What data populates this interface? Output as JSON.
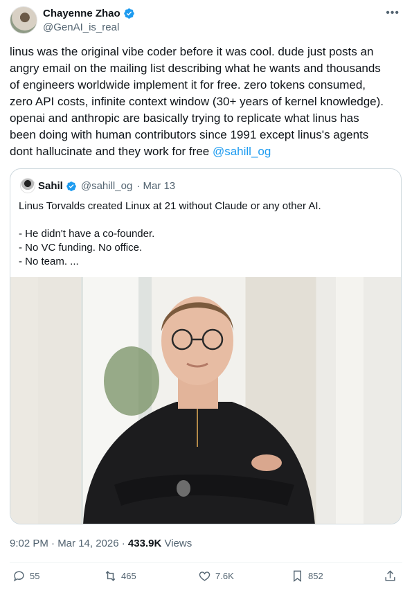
{
  "author": {
    "display_name": "Chayenne Zhao",
    "handle": "@GenAI_is_real",
    "verified": true
  },
  "tweet": {
    "text": "linus was the original vibe coder before it was cool. dude just posts an\nangry email on the mailing list describing what he wants and thousands\nof engineers worldwide implement it for free. zero tokens consumed,\nzero API costs, infinite context window (30+ years of kernel knowledge).\nopenai and anthropic are basically trying to replicate what linus has\nbeen doing with human contributors since 1991 except linus's agents\ndont hallucinate and they work for free ",
    "mention": "@sahill_og"
  },
  "quoted": {
    "display_name": "Sahil",
    "handle": "@sahill_og",
    "date": "· Mar 13",
    "text": "Linus Torvalds created Linux at 21 without Claude or any other AI.\n\n- He didn't have a co-founder.\n- No VC funding. No office.\n- No team.  ..."
  },
  "meta": {
    "time": "9:02 PM · Mar 14, 2026 · ",
    "views": "433.9K",
    "views_label": " Views"
  },
  "actions": {
    "replies": "55",
    "reposts": "465",
    "likes": "7.6K",
    "bookmarks": "852"
  },
  "colors": {
    "accent": "#1d9bf0",
    "muted": "#536471",
    "text": "#0f1419"
  },
  "icons": [
    "verified-badge-icon",
    "more-icon",
    "reply-icon",
    "repost-icon",
    "like-icon",
    "bookmark-icon",
    "share-icon"
  ]
}
